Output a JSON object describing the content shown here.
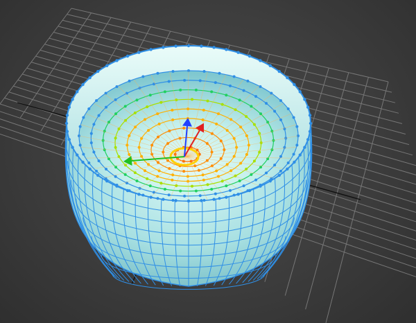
{
  "viewport": {
    "background": "#3d3d3d",
    "grid_color": "#777777",
    "grid_axis_color": "#111111",
    "object": "bowl-mesh",
    "object_color": "#aee6e8",
    "wire_color": "#2f8fe6",
    "soft_selection_colors": {
      "full": "#ff6a00",
      "high": "#ffb000",
      "mid": "#a8e000",
      "low": "#20d060",
      "none": "#2f8fe6"
    },
    "gizmo": {
      "x_color": "#e02020",
      "y_color": "#20c020",
      "z_color": "#2040ff",
      "center_color": "#ffd000"
    }
  }
}
